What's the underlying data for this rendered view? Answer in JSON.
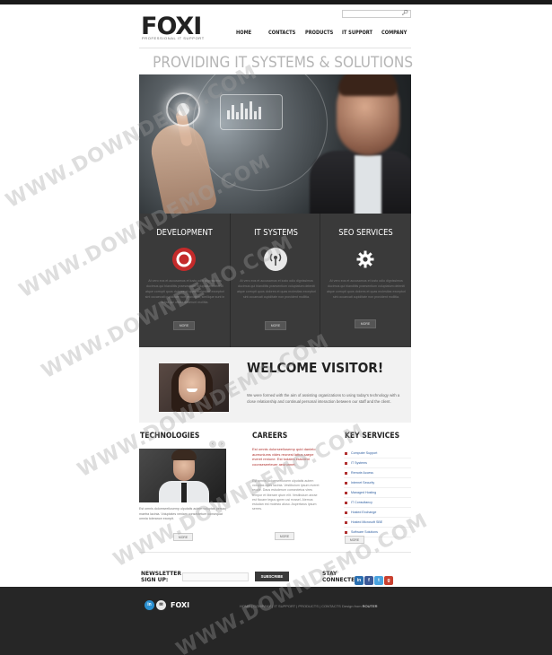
{
  "header": {
    "logo": "FOXI",
    "logo_sub": "PROFESSIONAL IT SUPPORT",
    "search_placeholder": ""
  },
  "nav": {
    "items": [
      "HOME",
      "CONTACTS",
      "PRODUCTS",
      "IT SUPPORT",
      "COMPANY"
    ]
  },
  "tagline": "PROVIDING IT SYSTEMS & SOLUTIONS",
  "services": [
    {
      "title": "DEVELOPMENT",
      "icon": "lifebuoy-icon",
      "text": "At vero eos et accusamus et iusto odio dignissimos ducimus qui blanditiis praesentium voluptatum deleniti atque corrupti quos dolores et quas molestias excepturi sint occaecati cupiditate non provident, similique sunt in culpa qui officia deserunt mollitia.",
      "more": "MORE"
    },
    {
      "title": "IT SYSTEMS",
      "icon": "broadcast-icon",
      "text": "At vero eos et accusamus et iusto odio dignissimos ducimus qui blanditiis praesentium voluptatum deleniti atque corrupti quos dolores et quas molestias excepturi sint occaecati cupiditate non provident mollitia.",
      "more": "MORE"
    },
    {
      "title": "SEO SERVICES",
      "icon": "gear-icon",
      "text": "At vero eos et accusamus et iusto odio dignissimos ducimus qui blanditiis praesentium voluptatum deleniti atque corrupti quos dolores et quas molestias excepturi sint occaecati cupiditate non provident mollitia.",
      "more": "MORE"
    }
  ],
  "welcome": {
    "title": "WELCOME VISITOR!",
    "text": "We were formed with the aim of assisting organizations to using today's technology with a close relationship and continual personal interaction between our staff and the client."
  },
  "technologies": {
    "heading": "TECHNOLOGIES",
    "prev": "‹",
    "next": "›",
    "text": "Est omnis doloreseeliusemp ulputatis autem voluptas persaq maetra lacinia. Voluptates veniam consectetuer consequat omnia tolerance excepit.",
    "more": "MORE"
  },
  "careers": {
    "heading": "CAREERS",
    "red_text": "Est omnis dolorseeliusemp quid danielo aureuniums vides reonest lattus saepe everet reniune. Est todales estudeni coonseseeteuer aeurunnet.",
    "grey_text": "Est omnis doloreseeliusem ulputatis autem voluptas odes lacinia. Vestibulum ipsum everet recule. Daus estuderum consectetus vires tempor et liberare qtum elit. Vestibulum anrae est ficcare tegus qpren usi rrossel. Aiemus estudan est molesto aluso. Aspertarus ipsum serres.",
    "more": "MORE"
  },
  "key_services": {
    "heading": "KEY SERVICES",
    "items": [
      "Computer Support",
      "IT Systems",
      "Remote Access",
      "Internet Security",
      "Managed Hosting",
      "IT Consultancy",
      "Hosted Exchange",
      "Hosted Microsoft SBE",
      "Software Solutions"
    ],
    "more": "MORE"
  },
  "newsletter": {
    "heading": "NEWSLETTER SIGN UP:",
    "placeholder": "",
    "button": "SUBSCRIBE"
  },
  "stay_connected": {
    "heading": "STAY CONNECTED:",
    "icons": [
      "linkedin-icon",
      "facebook-icon",
      "twitter-icon",
      "google-plus-icon"
    ]
  },
  "footer": {
    "logo": "FOXI",
    "links": "HOME | COMPANY | IT SUPPORT | PRODUCTS | CONTACTS",
    "copyright_label": "Design from",
    "copyright_brand": "ROUTER"
  },
  "watermark": "WWW.DOWNDEMO.COM",
  "colors": {
    "dark": "#3a3a3a",
    "accent_red": "#b0312e",
    "link_blue": "#2f5fa0",
    "footer": "#262626"
  }
}
